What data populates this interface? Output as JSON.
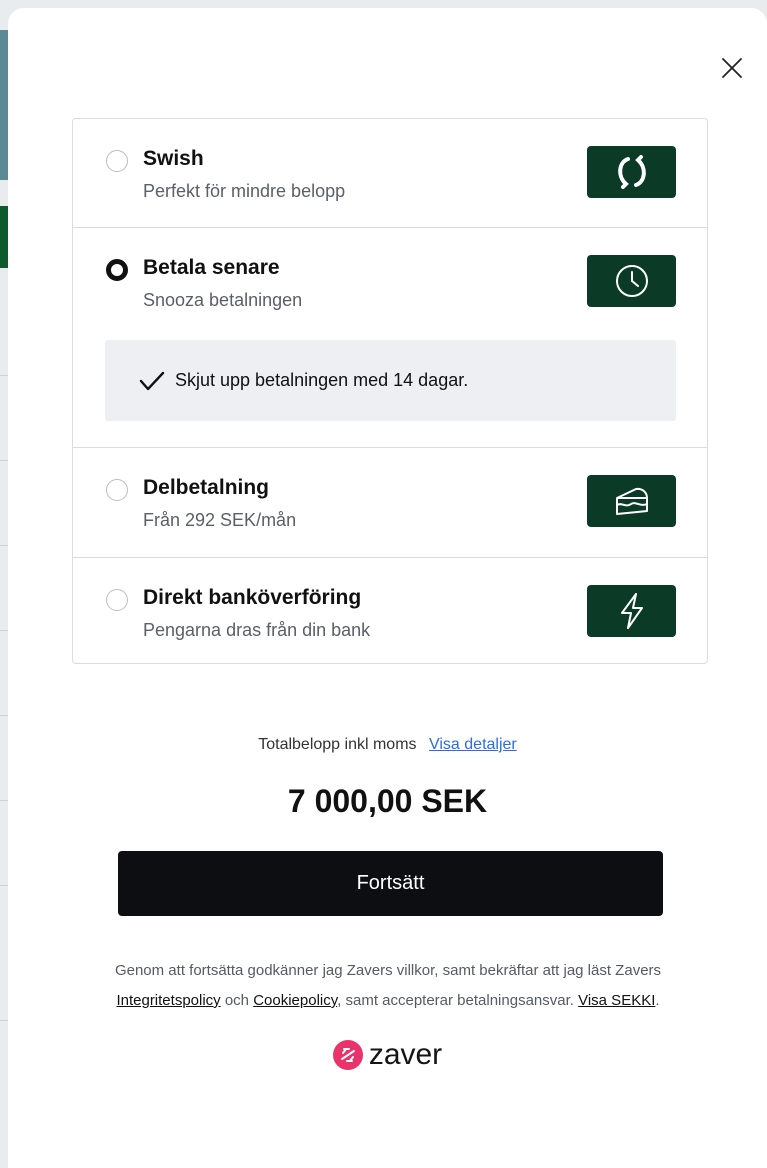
{
  "modal": {
    "close_label": "×"
  },
  "payment_options": [
    {
      "title": "Swish",
      "subtitle": "Perfekt för mindre belopp",
      "selected": false,
      "icon": "swish-icon"
    },
    {
      "title": "Betala senare",
      "subtitle": "Snooza betalningen",
      "selected": true,
      "icon": "clock-icon",
      "detail": "Skjut upp betalningen med 14 dagar."
    },
    {
      "title": "Delbetalning",
      "subtitle": "Från 292 SEK/mån",
      "selected": false,
      "icon": "cake-slice-icon"
    },
    {
      "title": "Direkt banköverföring",
      "subtitle": "Pengarna dras från din bank",
      "selected": false,
      "icon": "lightning-icon"
    }
  ],
  "summary": {
    "total_label": "Totalbelopp inkl moms",
    "details_link": "Visa detaljer",
    "amount": "7 000,00 SEK"
  },
  "continue_button": "Fortsätt",
  "terms": {
    "part1": "Genom att fortsätta godkänner jag Zavers villkor, samt bekräftar att jag läst Zavers",
    "privacy_link": "Integritetspolicy",
    "and": "och",
    "cookie_link": "Cookiepolicy",
    "part2": ", samt accepterar betalningsansvar.",
    "sekki_link": "Visa SEKKI",
    "end": "."
  },
  "brand": {
    "name": "zaver",
    "accent": "#e8336b",
    "badge_color": "#0b3b26"
  }
}
